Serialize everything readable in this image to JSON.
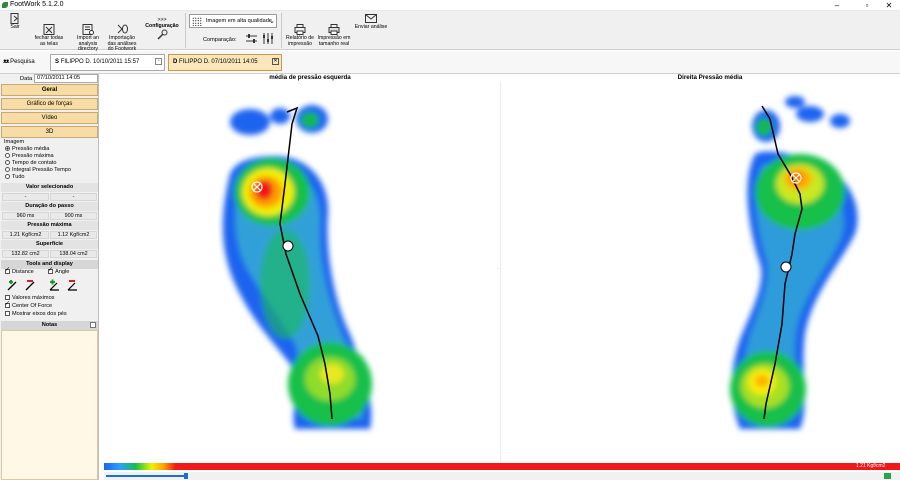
{
  "window": {
    "title": "FootWork 5.1.2.0"
  },
  "ribbon": {
    "sair": "Sair",
    "fechar": "fechar todas\nas telas",
    "import": "Import an\nanalysis\ndirectory",
    "importacao": "Importação\ndas análises\ndo Footwork",
    "config_arrows": ">>>",
    "configuracao": "Configuração",
    "quality_select": "Imagem em alta qualidade",
    "comparacao": "Comparação:",
    "relatorio": "Relatório de\nimpressão",
    "impressao": "Impressão em\ntamanho real",
    "enviar": "Enviar análise"
  },
  "tabs": {
    "pesquisa": "Pesquisa",
    "session1": "FILIPPO D. 10/10/2011 15:57",
    "session2": "FILIPPO D. 07/10/2011 14:05"
  },
  "left": {
    "data_label": "Data",
    "data_value": "07/10/2011 14:05",
    "btn_geral": "Geral",
    "btn_grafico": "Gráfico de forças",
    "btn_video": "Vídeo",
    "btn_3d": "3D",
    "imagem_label": "Imagem",
    "radios": [
      "Pressão média",
      "Pressão máxima",
      "Tempo de contato",
      "Integral Pressão Tempo",
      "Tudo"
    ],
    "sec_valor": "Valor selecionado",
    "valor_l": "-",
    "valor_r": "-",
    "sec_duracao": "Duração do passo",
    "duracao_l": "960 ms",
    "duracao_r": "900 ms",
    "sec_pressao": "Pressão máxima",
    "pressao_l": "1.21 Kgf/cm2",
    "pressao_r": "1.12 Kgf/cm2",
    "sec_superficie": "Superfície",
    "superficie_l": "132.82 cm2",
    "superficie_r": "138.04 cm2",
    "sec_tools": "Tools and display",
    "chk_distance": "Distance",
    "chk_angle": "Angle",
    "chk_valores": "Valores máximos",
    "chk_cof": "Center Of Force",
    "chk_eixos": "Mostrar eixos dos pés",
    "notas": "Notas"
  },
  "main": {
    "left_title": "média de pressão esquerda",
    "right_title": "Direita Pressão média",
    "scale_max": "1.21 Kgf/cm2"
  },
  "colors": {
    "ribbon": "#f0f0f0",
    "tab_active": "#fbe6bb",
    "header_orange": "#f7dca5"
  }
}
